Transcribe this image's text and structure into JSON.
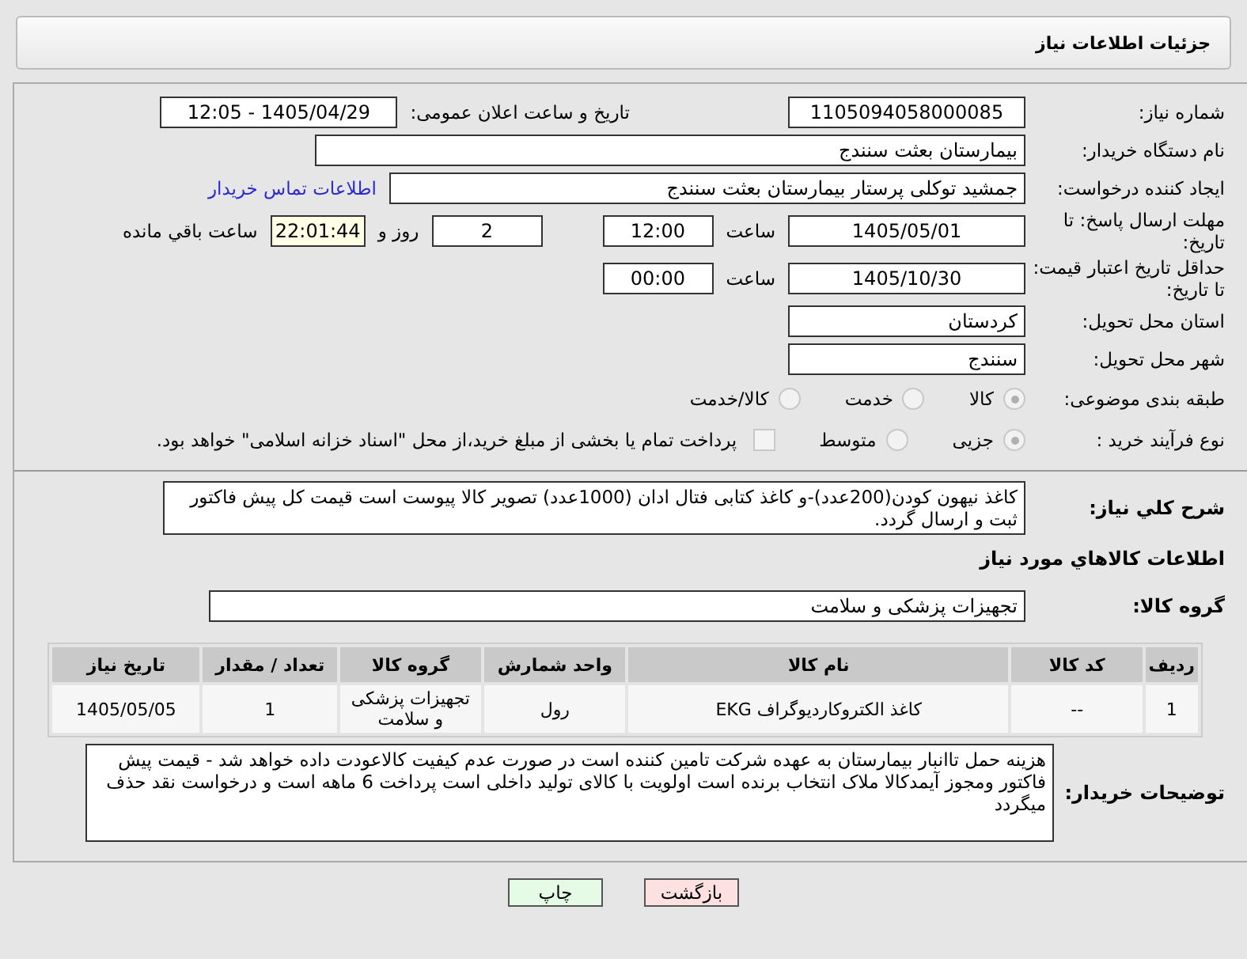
{
  "header": {
    "title": "جزئیات اطلاعات نیاز"
  },
  "need_number": {
    "label": "شماره نیاز:",
    "value": "1105094058000085"
  },
  "announce": {
    "label": "تاریخ و ساعت اعلان عمومی:",
    "value": "1405/04/29 - 12:05"
  },
  "buyer": {
    "label": "نام دستگاه خریدار:",
    "value": "بیمارستان بعثت سنندج"
  },
  "creator": {
    "label": "ایجاد کننده درخواست:",
    "value": "جمشید  توکلی پرستار بیمارستان بعثت سنندج",
    "link": "اطلاعات تماس خریدار"
  },
  "deadline": {
    "label": "مهلت ارسال پاسخ: تا تاریخ:",
    "date": "1405/05/01",
    "time_label": "ساعت",
    "time": "12:00",
    "days": "2",
    "days_label": "روز و",
    "remaining": "22:01:44",
    "remaining_label": "ساعت باقي مانده"
  },
  "validity": {
    "label": "حداقل تاریخ اعتبار قیمت: تا تاریخ:",
    "date": "1405/10/30",
    "time_label": "ساعت",
    "time": "00:00"
  },
  "province": {
    "label": "استان محل تحویل:",
    "value": "کردستان"
  },
  "city": {
    "label": "شهر محل تحویل:",
    "value": "سنندج"
  },
  "category": {
    "label": "طبقه بندی موضوعی:",
    "options": [
      {
        "label": "کالا",
        "selected": true
      },
      {
        "label": "خدمت",
        "selected": false
      },
      {
        "label": "کالا/خدمت",
        "selected": false
      }
    ]
  },
  "process": {
    "label": "نوع فرآیند خرید :",
    "options": [
      {
        "label": "جزیی",
        "selected": true
      },
      {
        "label": "متوسط",
        "selected": false
      }
    ],
    "payment": {
      "label": "پرداخت تمام یا بخشی از مبلغ خرید،از محل \"اسناد خزانه اسلامی\" خواهد بود.",
      "checked": false
    }
  },
  "description": {
    "label": "شرح کلي نياز:",
    "value": "کاغذ نیهون کودن(200عدد)-و کاغذ کتابی فتال ادان (1000عدد) تصویر کالا پیوست است قیمت کل پیش فاکتور ثبت و ارسال گردد."
  },
  "goods_heading": "اطلاعات کالاهاي مورد نياز",
  "goods_group": {
    "label": "گروه کالا:",
    "value": "تجهیزات پزشکی و سلامت"
  },
  "table": {
    "columns": [
      "ردیف",
      "کد کالا",
      "نام کالا",
      "واحد شمارش",
      "گروه کالا",
      "تعداد / مقدار",
      "تاریخ نیاز"
    ],
    "rows": [
      [
        "1",
        "--",
        "کاغذ الکتروکاردیوگراف EKG",
        "رول",
        "تجهیزات پزشکی و سلامت",
        "1",
        "1405/05/05"
      ]
    ]
  },
  "buyer_notes": {
    "label": "توضیحات خریدار:",
    "value": "هزینه حمل تاانبار بیمارستان به عهده شرکت تامین کننده است در صورت عدم کیفیت کالاعودت داده خواهد شد - قیمت پیش فاکتور ومجوز آیمدکالا ملاک انتخاب برنده است اولویت با کالای تولید داخلی است پرداخت 6 ماهه است و درخواست  نقد حذف میگردد"
  },
  "buttons": [
    {
      "label": "بازگشت",
      "kind": "back"
    },
    {
      "label": "چاپ",
      "kind": "print"
    }
  ]
}
